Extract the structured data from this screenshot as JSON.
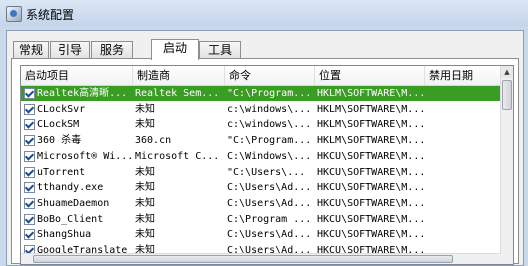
{
  "window": {
    "title": "系统配置"
  },
  "tabs": [
    "常规",
    "引导",
    "服务",
    "启动",
    "工具"
  ],
  "active_tab": "启动",
  "columns": [
    "启动项目",
    "制造商",
    "命令",
    "位置",
    "禁用日期"
  ],
  "rows": [
    {
      "item": "Realtek高清晰...",
      "maker": "Realtek Sem...",
      "cmd": "\"C:\\Program...",
      "loc": "HKLM\\SOFTWARE\\M...",
      "selected": true
    },
    {
      "item": "CLockSvr",
      "maker": "未知",
      "cmd": "c:\\windows\\...",
      "loc": "HKLM\\SOFTWARE\\M..."
    },
    {
      "item": "CLockSM",
      "maker": "未知",
      "cmd": "c:\\windows\\...",
      "loc": "HKLM\\SOFTWARE\\M..."
    },
    {
      "item": "360 杀毒",
      "maker": "360.cn",
      "cmd": "\"C:\\Program...",
      "loc": "HKLM\\SOFTWARE\\M..."
    },
    {
      "item": "Microsoft® Wi...",
      "maker": "Microsoft C...",
      "cmd": "C:\\Windows\\...",
      "loc": "HKCU\\SOFTWARE\\M..."
    },
    {
      "item": "uTorrent",
      "maker": "未知",
      "cmd": "\"C:\\Users\\...",
      "loc": "HKCU\\SOFTWARE\\M..."
    },
    {
      "item": "tthandy.exe",
      "maker": "未知",
      "cmd": "C:\\Users\\Ad...",
      "loc": "HKCU\\SOFTWARE\\M..."
    },
    {
      "item": "ShuameDaemon",
      "maker": "未知",
      "cmd": "C:\\Users\\Ad...",
      "loc": "HKCU\\SOFTWARE\\M..."
    },
    {
      "item": "BoBo_Client",
      "maker": "未知",
      "cmd": "C:\\Program ...",
      "loc": "HKCU\\SOFTWARE\\M..."
    },
    {
      "item": "ShangShua",
      "maker": "未知",
      "cmd": "C:\\Users\\Ad...",
      "loc": "HKCU\\SOFTWARE\\M..."
    },
    {
      "item": "GoogleTranslate",
      "maker": "未知",
      "cmd": "C:\\Users\\Ad...",
      "loc": "HKCU\\SOFTWARE\\M..."
    }
  ],
  "colors": {
    "selected_row": "#3a9d23",
    "check": "#1c4f8e"
  }
}
